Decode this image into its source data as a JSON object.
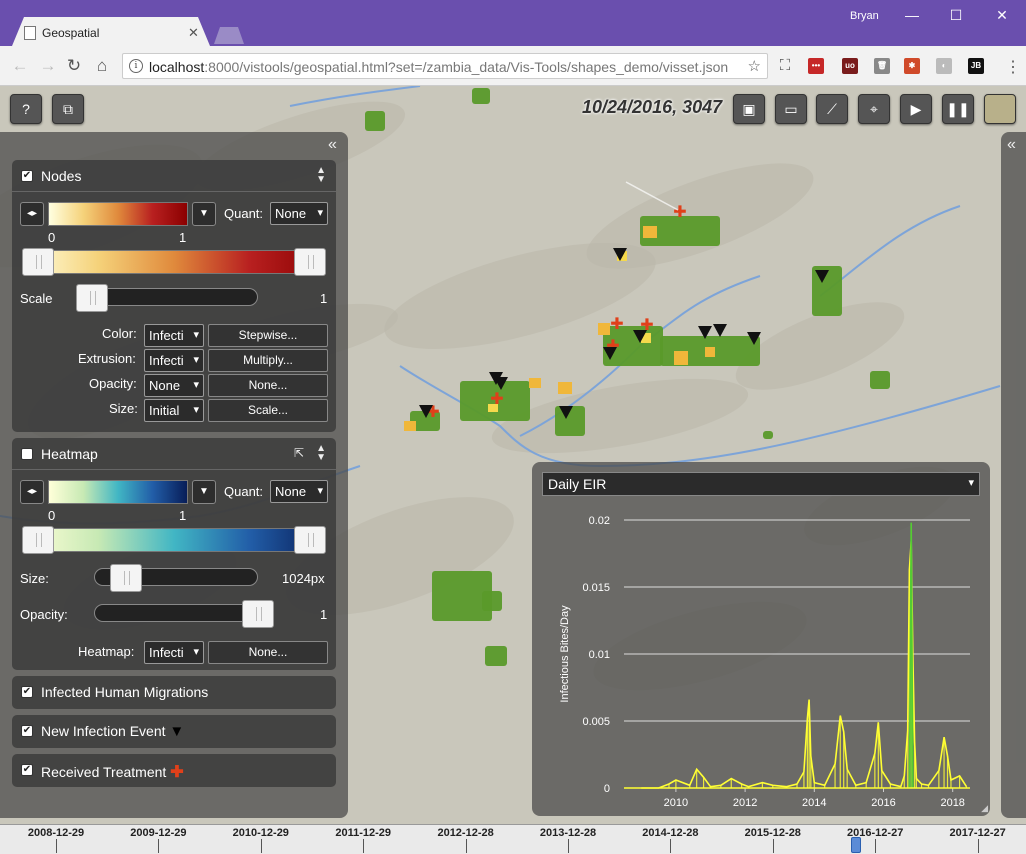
{
  "browser": {
    "tab_title": "Geospatial",
    "user": "Bryan",
    "url_host": "localhost",
    "url_path": ":8000/vistools/geospatial.html?set=/zambia_data/Vis-Tools/shapes_demo/visset.json",
    "extensions": [
      {
        "name": "lastpass-icon",
        "color": "#c62828",
        "glyph": "•••"
      },
      {
        "name": "ublock-icon",
        "color": "#7a1c1c",
        "glyph": "uo"
      },
      {
        "name": "trash-icon",
        "color": "#888888",
        "glyph": "🗑"
      },
      {
        "name": "pinwheel-icon",
        "color": "#d04a2a",
        "glyph": "✱"
      },
      {
        "name": "ghost-icon",
        "color": "#bbbbbb",
        "glyph": "◐"
      },
      {
        "name": "jb-icon",
        "color": "#111111",
        "glyph": "JB"
      }
    ]
  },
  "toolbar": {
    "datestamp": "10/24/2016, 3047",
    "buttons": [
      {
        "name": "help-button",
        "glyph": "?"
      },
      {
        "name": "layers-button",
        "glyph": "⧉"
      },
      {
        "name": "save-button",
        "glyph": "💾"
      },
      {
        "name": "open-folder-button",
        "glyph": "📂"
      },
      {
        "name": "chart-button",
        "glyph": "📈"
      },
      {
        "name": "recenter-button",
        "glyph": "⌖"
      },
      {
        "name": "play-button",
        "glyph": "▶"
      },
      {
        "name": "pause-button",
        "glyph": "❚❚"
      }
    ]
  },
  "nodes": {
    "title": "Nodes",
    "checked": true,
    "gradient_min": "0",
    "gradient_max": "1",
    "quant_label": "Quant:",
    "quant_value": "None",
    "scale_label": "Scale",
    "scale_value": "1",
    "color_label": "Color:",
    "color_value": "Infecti",
    "color_button": "Stepwise...",
    "extrusion_label": "Extrusion:",
    "extrusion_value": "Infecti",
    "extrusion_button": "Multiply...",
    "opacity_label": "Opacity:",
    "opacity_value": "None",
    "opacity_button": "None...",
    "size_label": "Size:",
    "size_value": "Initial",
    "size_button": "Scale..."
  },
  "heatmap": {
    "title": "Heatmap",
    "checked": false,
    "gradient_min": "0",
    "gradient_max": "1",
    "quant_label": "Quant:",
    "quant_value": "None",
    "size_label": "Size:",
    "size_value": "1024px",
    "opacity_label": "Opacity:",
    "opacity_value": "1",
    "heatmap_label": "Heatmap:",
    "heatmap_value": "Infecti",
    "heatmap_button": "None..."
  },
  "layers": [
    {
      "label": "Infected Human Migrations",
      "checked": true,
      "marker": ""
    },
    {
      "label": "New Infection Event",
      "checked": true,
      "marker": "▼"
    },
    {
      "label": "Received Treatment",
      "checked": true,
      "marker": "✚"
    }
  ],
  "chart_panel": {
    "selector": "Daily EIR"
  },
  "chart_data": {
    "type": "line",
    "title": "",
    "xlabel": "",
    "ylabel": "Infectious Bites/Day",
    "xlim": [
      2008.5,
      2018.5
    ],
    "ylim": [
      0,
      0.02
    ],
    "yticks": [
      0,
      0.005,
      0.01,
      0.015,
      0.02
    ],
    "ytick_labels": [
      "0",
      "0.005",
      "0.01",
      "0.015",
      "0.02"
    ],
    "xticks": [
      2010,
      2012,
      2014,
      2016,
      2018
    ],
    "xtick_labels": [
      "2010",
      "2012",
      "2014",
      "2016",
      "2018"
    ],
    "grid": true,
    "series": [
      {
        "color": "#ffff33",
        "x": [
          2009.0,
          2009.5,
          2009.8,
          2010.0,
          2010.4,
          2010.6,
          2010.8,
          2011.0,
          2011.3,
          2011.6,
          2011.9,
          2012.1,
          2012.5,
          2012.8,
          2013.2,
          2013.5,
          2013.7,
          2013.8,
          2013.85,
          2013.9,
          2014.0,
          2014.3,
          2014.6,
          2014.75,
          2014.85,
          2014.95,
          2015.2,
          2015.5,
          2015.75,
          2015.85,
          2015.95,
          2016.2,
          2016.5,
          2016.6,
          2016.7,
          2016.75,
          2016.8,
          2016.85,
          2016.9,
          2016.95,
          2017.1,
          2017.3,
          2017.6,
          2017.75,
          2017.85,
          2017.95,
          2018.2,
          2018.4
        ],
        "values": [
          0,
          0,
          0.0003,
          0.0006,
          0.0002,
          0.0014,
          0.0008,
          0.0001,
          0.0002,
          0.0007,
          0.0003,
          0.0001,
          0.0004,
          0.0002,
          0.0001,
          0.0003,
          0.0012,
          0.0052,
          0.0066,
          0.0024,
          0.0004,
          0.0002,
          0.0018,
          0.0054,
          0.0042,
          0.0014,
          0.0002,
          0.0004,
          0.0026,
          0.0049,
          0.0013,
          0.0003,
          0.0001,
          0.0009,
          0.0043,
          0.0163,
          0.0184,
          0.0097,
          0.0034,
          0.0007,
          0.0003,
          0.0002,
          0.0013,
          0.0038,
          0.0024,
          0.0006,
          0.0009,
          0.0001
        ]
      },
      {
        "color": "#55cc33",
        "x": [
          2016.75,
          2016.8,
          2016.85
        ],
        "values": [
          0.0,
          0.0198,
          0.0
        ]
      }
    ]
  },
  "timeline": {
    "labels": [
      "2008-12-29",
      "2009-12-29",
      "2010-12-29",
      "2011-12-29",
      "2012-12-28",
      "2013-12-28",
      "2014-12-28",
      "2015-12-28",
      "2016-12-27",
      "2017-12-27"
    ]
  }
}
